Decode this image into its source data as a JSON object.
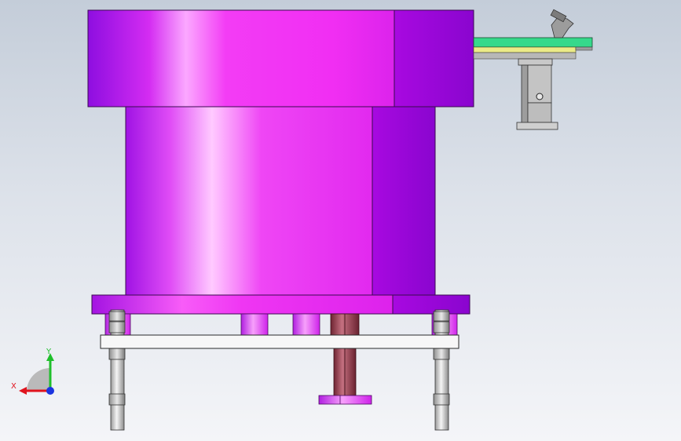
{
  "colors": {
    "bowl": "#e01ee8",
    "bowl_shadow": "#9a08d4",
    "bracket": "#a9a9a9",
    "track_green": "#34d88a",
    "track_yellow": "#e9ea8a",
    "cylinder": "#8a3a4a",
    "axis_x": "#e0141e",
    "axis_y": "#1fbf2b",
    "axis_z": "#1b34e0"
  },
  "triad": {
    "x_label": "X",
    "y_label": "Y"
  }
}
